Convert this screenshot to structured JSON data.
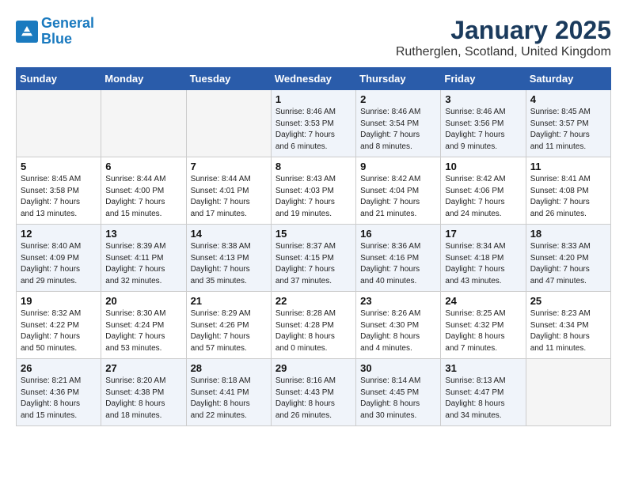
{
  "header": {
    "logo_line1": "General",
    "logo_line2": "Blue",
    "month": "January 2025",
    "location": "Rutherglen, Scotland, United Kingdom"
  },
  "weekdays": [
    "Sunday",
    "Monday",
    "Tuesday",
    "Wednesday",
    "Thursday",
    "Friday",
    "Saturday"
  ],
  "weeks": [
    [
      {
        "day": "",
        "detail": ""
      },
      {
        "day": "",
        "detail": ""
      },
      {
        "day": "",
        "detail": ""
      },
      {
        "day": "1",
        "detail": "Sunrise: 8:46 AM\nSunset: 3:53 PM\nDaylight: 7 hours\nand 6 minutes."
      },
      {
        "day": "2",
        "detail": "Sunrise: 8:46 AM\nSunset: 3:54 PM\nDaylight: 7 hours\nand 8 minutes."
      },
      {
        "day": "3",
        "detail": "Sunrise: 8:46 AM\nSunset: 3:56 PM\nDaylight: 7 hours\nand 9 minutes."
      },
      {
        "day": "4",
        "detail": "Sunrise: 8:45 AM\nSunset: 3:57 PM\nDaylight: 7 hours\nand 11 minutes."
      }
    ],
    [
      {
        "day": "5",
        "detail": "Sunrise: 8:45 AM\nSunset: 3:58 PM\nDaylight: 7 hours\nand 13 minutes."
      },
      {
        "day": "6",
        "detail": "Sunrise: 8:44 AM\nSunset: 4:00 PM\nDaylight: 7 hours\nand 15 minutes."
      },
      {
        "day": "7",
        "detail": "Sunrise: 8:44 AM\nSunset: 4:01 PM\nDaylight: 7 hours\nand 17 minutes."
      },
      {
        "day": "8",
        "detail": "Sunrise: 8:43 AM\nSunset: 4:03 PM\nDaylight: 7 hours\nand 19 minutes."
      },
      {
        "day": "9",
        "detail": "Sunrise: 8:42 AM\nSunset: 4:04 PM\nDaylight: 7 hours\nand 21 minutes."
      },
      {
        "day": "10",
        "detail": "Sunrise: 8:42 AM\nSunset: 4:06 PM\nDaylight: 7 hours\nand 24 minutes."
      },
      {
        "day": "11",
        "detail": "Sunrise: 8:41 AM\nSunset: 4:08 PM\nDaylight: 7 hours\nand 26 minutes."
      }
    ],
    [
      {
        "day": "12",
        "detail": "Sunrise: 8:40 AM\nSunset: 4:09 PM\nDaylight: 7 hours\nand 29 minutes."
      },
      {
        "day": "13",
        "detail": "Sunrise: 8:39 AM\nSunset: 4:11 PM\nDaylight: 7 hours\nand 32 minutes."
      },
      {
        "day": "14",
        "detail": "Sunrise: 8:38 AM\nSunset: 4:13 PM\nDaylight: 7 hours\nand 35 minutes."
      },
      {
        "day": "15",
        "detail": "Sunrise: 8:37 AM\nSunset: 4:15 PM\nDaylight: 7 hours\nand 37 minutes."
      },
      {
        "day": "16",
        "detail": "Sunrise: 8:36 AM\nSunset: 4:16 PM\nDaylight: 7 hours\nand 40 minutes."
      },
      {
        "day": "17",
        "detail": "Sunrise: 8:34 AM\nSunset: 4:18 PM\nDaylight: 7 hours\nand 43 minutes."
      },
      {
        "day": "18",
        "detail": "Sunrise: 8:33 AM\nSunset: 4:20 PM\nDaylight: 7 hours\nand 47 minutes."
      }
    ],
    [
      {
        "day": "19",
        "detail": "Sunrise: 8:32 AM\nSunset: 4:22 PM\nDaylight: 7 hours\nand 50 minutes."
      },
      {
        "day": "20",
        "detail": "Sunrise: 8:30 AM\nSunset: 4:24 PM\nDaylight: 7 hours\nand 53 minutes."
      },
      {
        "day": "21",
        "detail": "Sunrise: 8:29 AM\nSunset: 4:26 PM\nDaylight: 7 hours\nand 57 minutes."
      },
      {
        "day": "22",
        "detail": "Sunrise: 8:28 AM\nSunset: 4:28 PM\nDaylight: 8 hours\nand 0 minutes."
      },
      {
        "day": "23",
        "detail": "Sunrise: 8:26 AM\nSunset: 4:30 PM\nDaylight: 8 hours\nand 4 minutes."
      },
      {
        "day": "24",
        "detail": "Sunrise: 8:25 AM\nSunset: 4:32 PM\nDaylight: 8 hours\nand 7 minutes."
      },
      {
        "day": "25",
        "detail": "Sunrise: 8:23 AM\nSunset: 4:34 PM\nDaylight: 8 hours\nand 11 minutes."
      }
    ],
    [
      {
        "day": "26",
        "detail": "Sunrise: 8:21 AM\nSunset: 4:36 PM\nDaylight: 8 hours\nand 15 minutes."
      },
      {
        "day": "27",
        "detail": "Sunrise: 8:20 AM\nSunset: 4:38 PM\nDaylight: 8 hours\nand 18 minutes."
      },
      {
        "day": "28",
        "detail": "Sunrise: 8:18 AM\nSunset: 4:41 PM\nDaylight: 8 hours\nand 22 minutes."
      },
      {
        "day": "29",
        "detail": "Sunrise: 8:16 AM\nSunset: 4:43 PM\nDaylight: 8 hours\nand 26 minutes."
      },
      {
        "day": "30",
        "detail": "Sunrise: 8:14 AM\nSunset: 4:45 PM\nDaylight: 8 hours\nand 30 minutes."
      },
      {
        "day": "31",
        "detail": "Sunrise: 8:13 AM\nSunset: 4:47 PM\nDaylight: 8 hours\nand 34 minutes."
      },
      {
        "day": "",
        "detail": ""
      }
    ]
  ]
}
